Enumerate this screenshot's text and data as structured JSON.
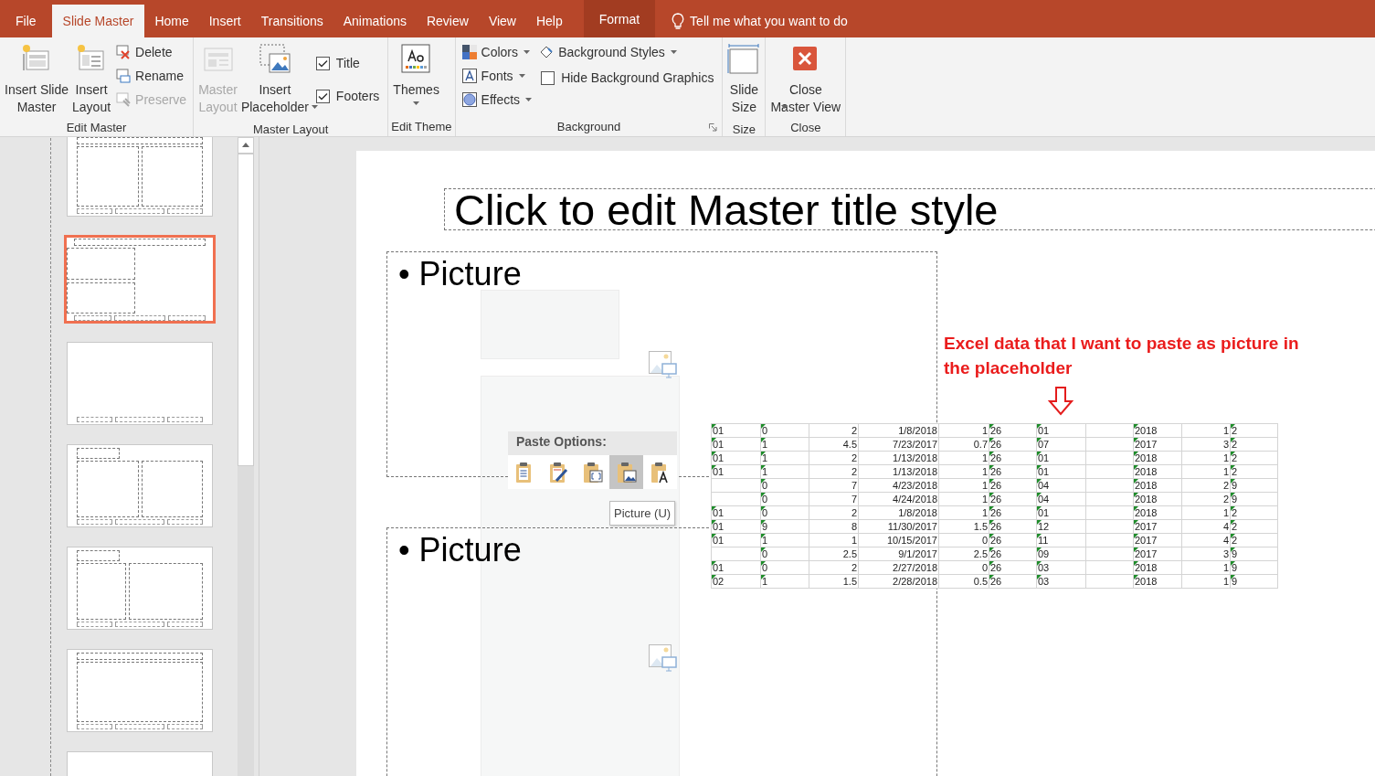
{
  "tabs": [
    {
      "label": "File",
      "selected": false,
      "kind": "tab"
    },
    {
      "label": "Slide Master",
      "selected": true,
      "kind": "tab"
    },
    {
      "label": "Home",
      "selected": false,
      "kind": "tab"
    },
    {
      "label": "Insert",
      "selected": false,
      "kind": "tab"
    },
    {
      "label": "Transitions",
      "selected": false,
      "kind": "tab"
    },
    {
      "label": "Animations",
      "selected": false,
      "kind": "tab"
    },
    {
      "label": "Review",
      "selected": false,
      "kind": "tab"
    },
    {
      "label": "View",
      "selected": false,
      "kind": "tab"
    },
    {
      "label": "Help",
      "selected": false,
      "kind": "tab"
    },
    {
      "label": "Format",
      "selected": false,
      "kind": "contextual"
    }
  ],
  "tell_me": "Tell me what you want to do",
  "ribbon": [
    {
      "label": "Edit Master",
      "columns": [
        [
          {
            "kind": "large",
            "lines": [
              "Insert Slide",
              "Master"
            ],
            "disabled": false,
            "dropdown": false
          }
        ],
        [
          {
            "kind": "large",
            "lines": [
              "Insert",
              "Layout"
            ],
            "disabled": false,
            "dropdown": false
          }
        ],
        [
          {
            "kind": "small",
            "label": "Delete",
            "disabled": false,
            "dropdown": false
          },
          {
            "kind": "small",
            "label": "Rename",
            "disabled": false,
            "dropdown": false
          },
          {
            "kind": "small",
            "label": "Preserve",
            "disabled": true,
            "dropdown": false
          }
        ]
      ]
    },
    {
      "label": "Master Layout",
      "columns": [
        [
          {
            "kind": "large",
            "lines": [
              "Master",
              "Layout"
            ],
            "disabled": true,
            "dropdown": false
          }
        ],
        [
          {
            "kind": "large",
            "lines": [
              "Insert",
              "Placeholder"
            ],
            "disabled": false,
            "dropdown": true
          }
        ],
        [
          {
            "kind": "checkbox",
            "label": "Title",
            "checked": true
          },
          {
            "kind": "checkbox",
            "label": "Footers",
            "checked": true
          }
        ]
      ]
    },
    {
      "label": "Edit Theme",
      "columns": [
        [
          {
            "kind": "large",
            "lines": [
              "Themes"
            ],
            "disabled": false,
            "dropdown": true
          }
        ]
      ]
    },
    {
      "label": "Background",
      "launcher": true,
      "columns": [
        [
          {
            "kind": "small",
            "label": "Colors",
            "disabled": false,
            "dropdown": true
          },
          {
            "kind": "small",
            "label": "Fonts",
            "disabled": false,
            "dropdown": true
          },
          {
            "kind": "small",
            "label": "Effects",
            "disabled": false,
            "dropdown": true
          }
        ],
        [
          {
            "kind": "small",
            "label": "Background Styles",
            "disabled": false,
            "dropdown": true
          },
          {
            "kind": "checkbox",
            "label": "Hide Background Graphics",
            "checked": false
          }
        ]
      ]
    },
    {
      "label": "Size",
      "columns": [
        [
          {
            "kind": "large",
            "lines": [
              "Slide",
              "Size"
            ],
            "disabled": false,
            "dropdown": true
          }
        ]
      ]
    },
    {
      "label": "Close",
      "columns": [
        [
          {
            "kind": "large",
            "lines": [
              "Close",
              "Master View"
            ],
            "disabled": false,
            "dropdown": false
          }
        ]
      ]
    }
  ],
  "thumbnails": [
    {
      "kind": "two-content",
      "selected": false
    },
    {
      "kind": "two-picture",
      "selected": true
    },
    {
      "kind": "blank",
      "selected": false
    },
    {
      "kind": "content-caption",
      "selected": false
    },
    {
      "kind": "picture-caption",
      "selected": false
    },
    {
      "kind": "vertical",
      "selected": false
    },
    {
      "kind": "blank",
      "selected": false
    }
  ],
  "slide": {
    "title": "Click to edit Master title style",
    "placeholders": [
      "• Picture",
      "• Picture"
    ],
    "paste_options": {
      "title": "Paste Options:",
      "buttons": [
        {
          "selected": false
        },
        {
          "selected": false
        },
        {
          "selected": false
        },
        {
          "selected": true
        },
        {
          "selected": false
        }
      ],
      "tooltip": "Picture (U)"
    },
    "annotation": "Excel data that I want to paste as picture in the placeholder",
    "excel_table": {
      "rows": [
        [
          "01",
          "0",
          "2",
          "1/8/2018",
          "1",
          "26",
          "01",
          "",
          "2018",
          "1",
          "2"
        ],
        [
          "01",
          "1",
          "4.5",
          "7/23/2017",
          "0.7",
          "26",
          "07",
          "",
          "2017",
          "3",
          "2"
        ],
        [
          "01",
          "1",
          "2",
          "1/13/2018",
          "1",
          "26",
          "01",
          "",
          "2018",
          "1",
          "2"
        ],
        [
          "01",
          "1",
          "2",
          "1/13/2018",
          "1",
          "26",
          "01",
          "",
          "2018",
          "1",
          "2"
        ],
        [
          "",
          "0",
          "7",
          "4/23/2018",
          "1",
          "26",
          "04",
          "",
          "2018",
          "2",
          "9"
        ],
        [
          "",
          "0",
          "7",
          "4/24/2018",
          "1",
          "26",
          "04",
          "",
          "2018",
          "2",
          "9"
        ],
        [
          "01",
          "0",
          "2",
          "1/8/2018",
          "1",
          "26",
          "01",
          "",
          "2018",
          "1",
          "2"
        ],
        [
          "01",
          "9",
          "8",
          "11/30/2017",
          "1.5",
          "26",
          "12",
          "",
          "2017",
          "4",
          "2"
        ],
        [
          "01",
          "1",
          "1",
          "10/15/2017",
          "0",
          "26",
          "11",
          "",
          "2017",
          "4",
          "2"
        ],
        [
          "",
          "0",
          "2.5",
          "9/1/2017",
          "2.5",
          "26",
          "09",
          "",
          "2017",
          "3",
          "9"
        ],
        [
          "01",
          "0",
          "2",
          "2/27/2018",
          "0",
          "26",
          "03",
          "",
          "2018",
          "1",
          "9"
        ],
        [
          "02",
          "1",
          "1.5",
          "2/28/2018",
          "0.5",
          "26",
          "03",
          "",
          "2018",
          "1",
          "9"
        ]
      ]
    }
  }
}
